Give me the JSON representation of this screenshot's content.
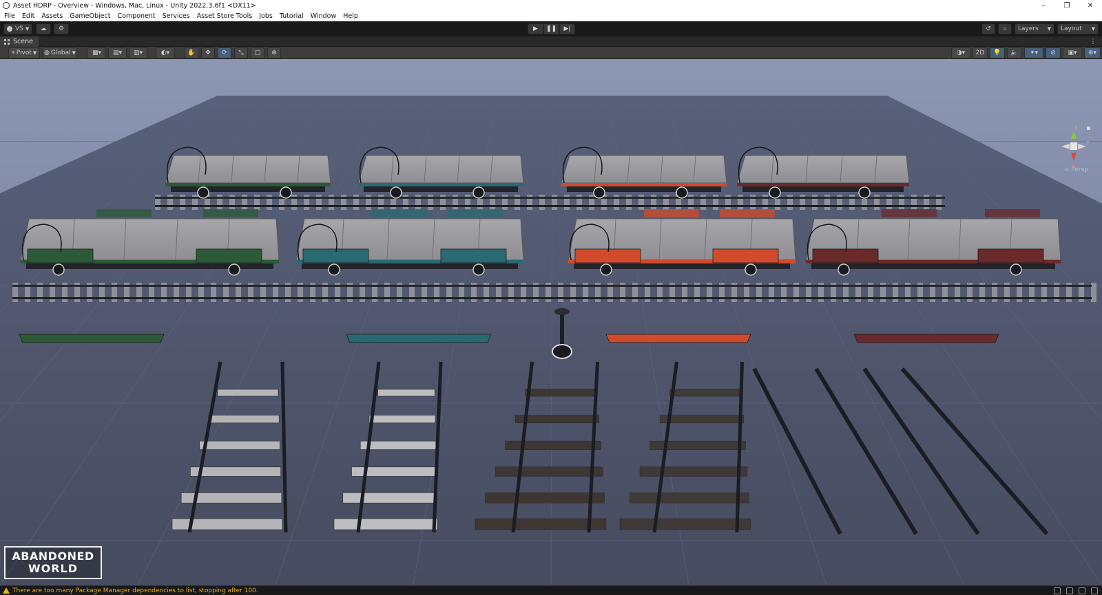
{
  "window": {
    "title": "Asset HDRP - Overview - Windows, Mac, Linux - Unity 2022.3.6f1 <DX11>",
    "controls": [
      "–",
      "❐",
      "✕"
    ]
  },
  "menu": [
    "File",
    "Edit",
    "Assets",
    "GameObject",
    "Component",
    "Services",
    "Asset Store Tools",
    "Jobs",
    "Tutorial",
    "Window",
    "Help"
  ],
  "toolbar": {
    "account_label": "VS",
    "layers_label": "Layers",
    "layout_label": "Layout"
  },
  "scene_tab": {
    "label": "Scene"
  },
  "scene_toolbar": {
    "pivot_label": "Pivot",
    "global_label": "Global",
    "mode_2d_label": "2D"
  },
  "gizmo": {
    "y_label": "y",
    "x_label": "x",
    "z_label": "z",
    "persp_label": "< Persp"
  },
  "logo": {
    "line1": "ABANDONED",
    "line2": "WORLD"
  },
  "status": {
    "message": "There are too many Package Manager dependencies to list, stopping after 100."
  },
  "colors": {
    "wagon_green": "#2c5a37",
    "wagon_teal": "#2a6a72",
    "wagon_orange": "#d04a2c",
    "wagon_maroon": "#6b2a2a",
    "warning": "#e6b020"
  }
}
